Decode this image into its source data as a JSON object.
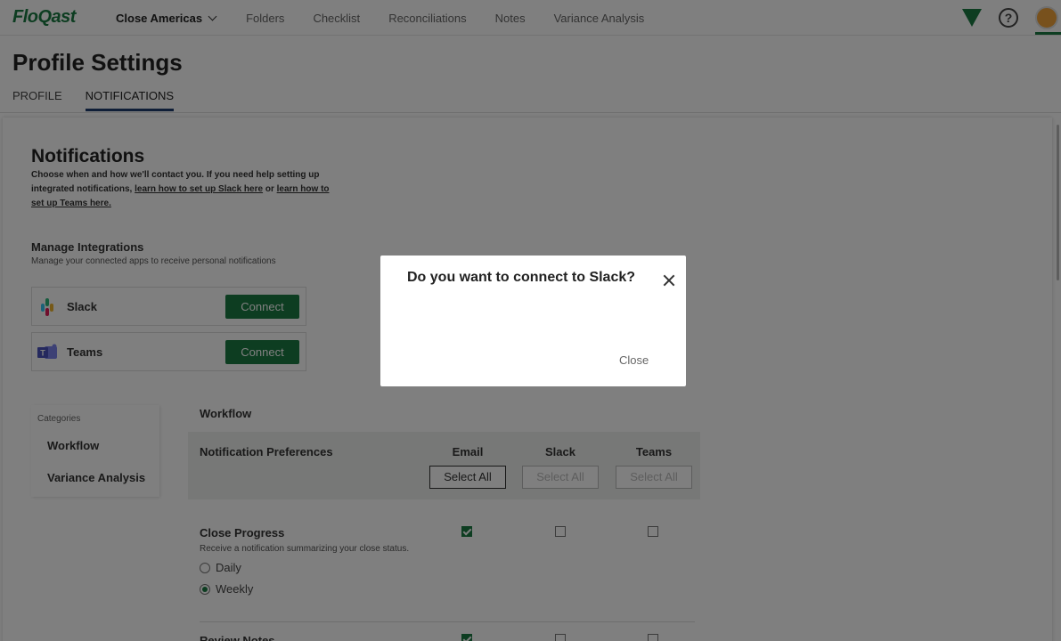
{
  "app": {
    "logo": "FloQast",
    "nav": [
      "Close Americas",
      "Folders",
      "Checklist",
      "Reconciliations",
      "Notes",
      "Variance Analysis"
    ],
    "help_symbol": "?"
  },
  "page": {
    "title": "Profile Settings",
    "tabs": [
      {
        "label": "PROFILE",
        "active": false
      },
      {
        "label": "NOTIFICATIONS",
        "active": true
      }
    ]
  },
  "notifications": {
    "title": "Notifications",
    "desc_text": "Choose when and how we'll contact you. If you need help setting up integrated notifications,",
    "link_slack": "learn how to set up Slack here",
    "or": "or",
    "link_teams": "learn how to set up Teams here."
  },
  "integrations": {
    "title": "Manage Integrations",
    "subtitle": "Manage your connected apps to receive personal notifications",
    "items": [
      {
        "name": "Slack",
        "button": "Connect",
        "icon": "slack-logo-icon"
      },
      {
        "name": "Teams",
        "button": "Connect",
        "icon": "teams-logo-icon"
      }
    ]
  },
  "categories": {
    "label": "Categories",
    "items": [
      "Workflow",
      "Variance Analysis"
    ]
  },
  "workflow": {
    "title": "Workflow",
    "preferences_label": "Notification Preferences",
    "columns": [
      "Email",
      "Slack",
      "Teams"
    ],
    "select_all": "Select All",
    "close_progress": {
      "title": "Close Progress",
      "subtitle": "Receive a notification summarizing your close status.",
      "options": [
        {
          "label": "Daily",
          "selected": false
        },
        {
          "label": "Weekly",
          "selected": true
        }
      ],
      "email": true,
      "slack": false,
      "teams": false
    },
    "review_notes": {
      "title": "Review Notes"
    }
  },
  "modal": {
    "title": "Do you want to connect to Slack?",
    "close_label": "Close"
  },
  "colors": {
    "brand_green": "#1b7a43",
    "tab_underline": "#1e3c6e"
  }
}
